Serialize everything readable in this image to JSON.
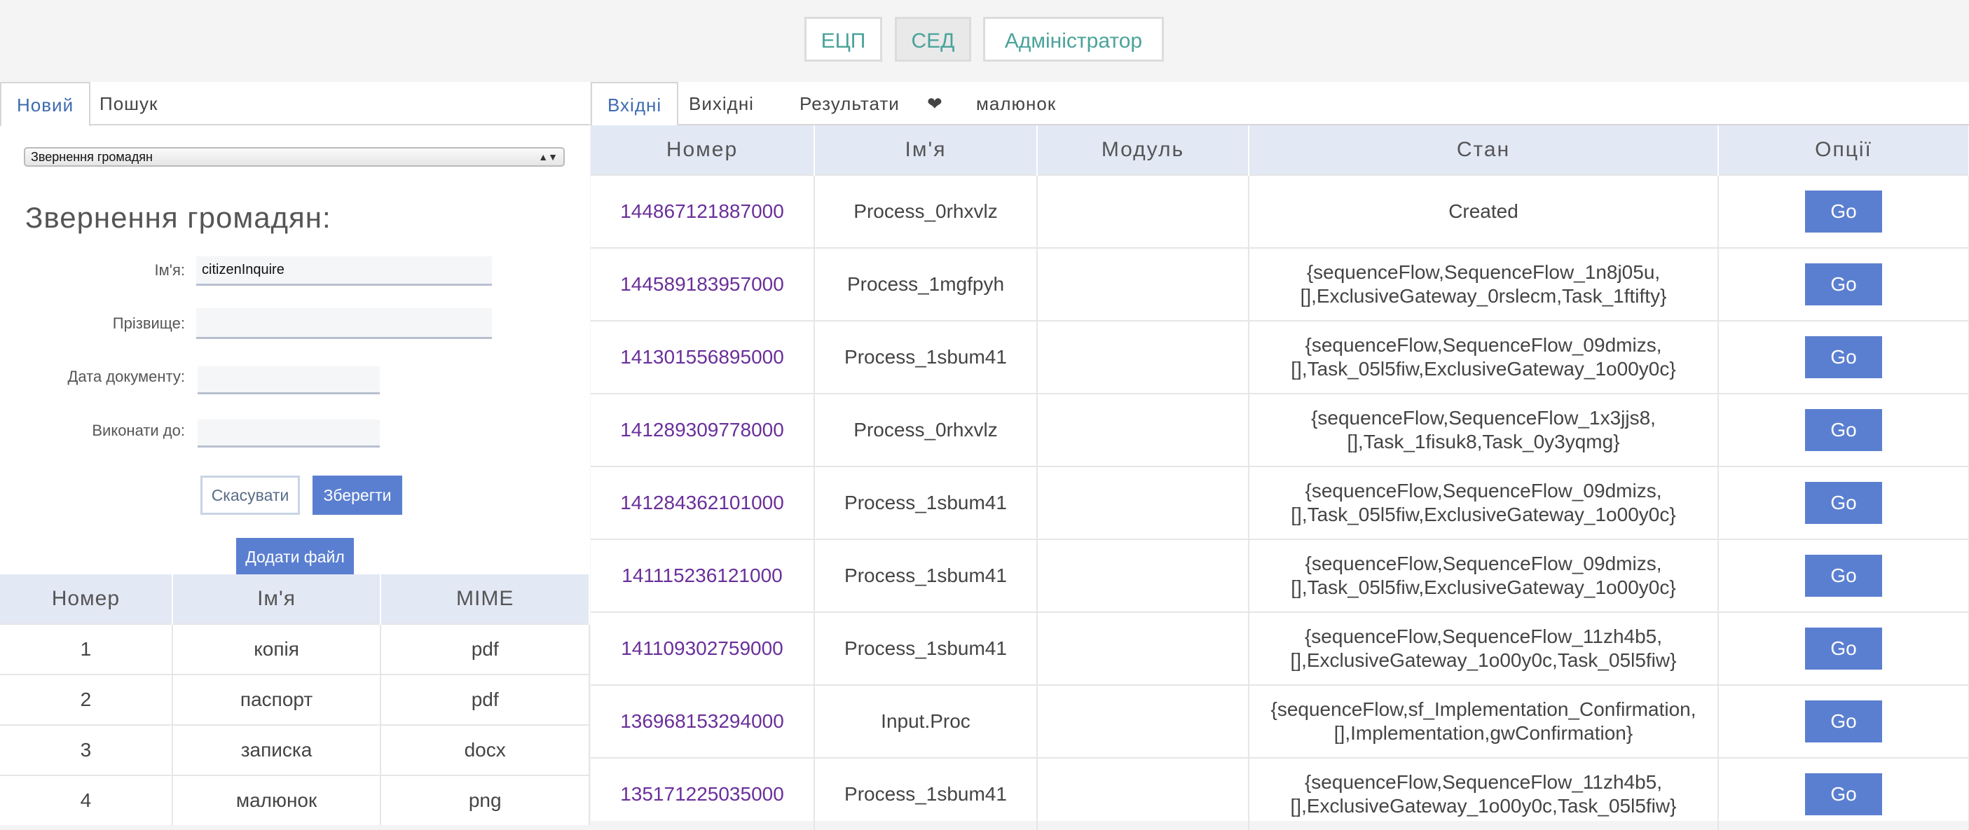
{
  "topnav": {
    "ecp": "ЕЦП",
    "sed": "СЕД",
    "admin": "Адміністратор"
  },
  "left": {
    "tabs": [
      "Новий",
      "Пошук"
    ],
    "select_value": "Звернення громадян",
    "form_title": "Звернення громадян:",
    "fields": [
      {
        "label": "Ім'я:",
        "value": "citizenInquire"
      },
      {
        "label": "Прізвище:",
        "value": ""
      },
      {
        "label": "Дата документу:",
        "value": ""
      },
      {
        "label": "Виконати до:",
        "value": ""
      }
    ],
    "cancel_label": "Скасувати",
    "save_label": "Зберегти",
    "add_file_label": "Додати файл",
    "files": {
      "headers": [
        "Номер",
        "Ім'я",
        "MIME"
      ],
      "rows": [
        [
          "1",
          "копія",
          "pdf"
        ],
        [
          "2",
          "паспорт",
          "pdf"
        ],
        [
          "3",
          "записка",
          "docx"
        ],
        [
          "4",
          "малюнок",
          "png"
        ]
      ]
    }
  },
  "right": {
    "tabs": [
      "Вхідні",
      "Вихідні",
      "Результати",
      "❤",
      "малюнок"
    ],
    "table": {
      "headers": [
        "Номер",
        "Ім'я",
        "Модуль",
        "Стан",
        "Опції"
      ],
      "go_label": "Go",
      "rows": [
        [
          "144867121887000",
          "Process_0rhxvlz",
          "",
          "Created"
        ],
        [
          "144589183957000",
          "Process_1mgfpyh",
          "",
          "{sequenceFlow,SequenceFlow_1n8j05u,\n[],ExclusiveGateway_0rslecm,Task_1ftifty}"
        ],
        [
          "141301556895000",
          "Process_1sbum41",
          "",
          "{sequenceFlow,SequenceFlow_09dmizs,\n[],Task_05l5fiw,ExclusiveGateway_1o00y0c}"
        ],
        [
          "141289309778000",
          "Process_0rhxvlz",
          "",
          "{sequenceFlow,SequenceFlow_1x3jjs8,\n[],Task_1fisuk8,Task_0y3yqmg}"
        ],
        [
          "141284362101000",
          "Process_1sbum41",
          "",
          "{sequenceFlow,SequenceFlow_09dmizs,\n[],Task_05l5fiw,ExclusiveGateway_1o00y0c}"
        ],
        [
          "141115236121000",
          "Process_1sbum41",
          "",
          "{sequenceFlow,SequenceFlow_09dmizs,\n[],Task_05l5fiw,ExclusiveGateway_1o00y0c}"
        ],
        [
          "141109302759000",
          "Process_1sbum41",
          "",
          "{sequenceFlow,SequenceFlow_11zh4b5,\n[],ExclusiveGateway_1o00y0c,Task_05l5fiw}"
        ],
        [
          "136968153294000",
          "Input.Proc",
          "",
          "{sequenceFlow,sf_Implementation_Confirmation,\n[],Implementation,gwConfirmation}"
        ],
        [
          "135171225035000",
          "Process_1sbum41",
          "",
          "{sequenceFlow,SequenceFlow_11zh4b5,\n[],ExclusiveGateway_1o00y0c,Task_05l5fiw}"
        ]
      ]
    }
  }
}
